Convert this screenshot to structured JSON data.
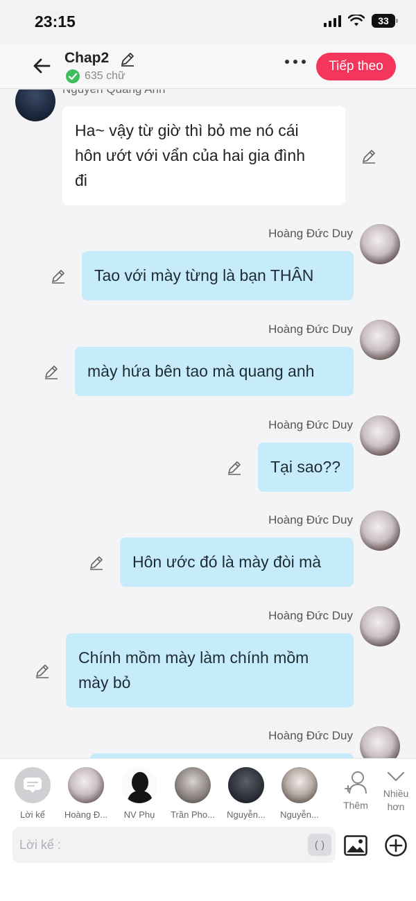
{
  "status_bar": {
    "time": "23:15",
    "battery": "33"
  },
  "header": {
    "title": "Chap2",
    "word_count": "635 chữ",
    "next_label": "Tiếp theo"
  },
  "colors": {
    "accent": "#f5365c",
    "bubble_right": "#c6ecfb",
    "bubble_left": "#ffffff",
    "verified": "#3cbf5c"
  },
  "messages": [
    {
      "side": "left",
      "sender": "Nguyen Quang Anh",
      "text": [
        "Ha~ vậy từ giờ thì bỏ me nó cái",
        "hôn ướt với vẩn của hai gia đình",
        "đi"
      ]
    },
    {
      "side": "right",
      "sender": "Hoàng Đức Duy",
      "text": [
        "Tao với mày từng là bạn THÂN"
      ]
    },
    {
      "side": "right",
      "sender": "Hoàng Đức Duy",
      "text": [
        "mày hứa bên tao mà quang anh"
      ]
    },
    {
      "side": "right",
      "sender": "Hoàng Đức Duy",
      "text": [
        "Tại sao??"
      ]
    },
    {
      "side": "right",
      "sender": "Hoàng Đức Duy",
      "text": [
        "Hôn ước đó là mày đòi mà"
      ]
    },
    {
      "side": "right",
      "sender": "Hoàng Đức Duy",
      "text": [
        "Chính mồm mày làm chính mồm",
        "mày bỏ"
      ]
    },
    {
      "side": "right",
      "sender": "Hoàng Đức Duy",
      "text": []
    }
  ],
  "characters": [
    {
      "label": "Lời kể",
      "icon": "narrator-icon"
    },
    {
      "label": "Hoàng Đ..."
    },
    {
      "label": "NV Phụ"
    },
    {
      "label": "Trần Pho..."
    },
    {
      "label": "Nguyễn..."
    },
    {
      "label": "Nguyễn..."
    }
  ],
  "add_character_label": "Thêm",
  "more_label_1": "Nhiều",
  "more_label_2": "hơn",
  "composer": {
    "placeholder": "Lời kể :",
    "paren_label": "( )"
  }
}
